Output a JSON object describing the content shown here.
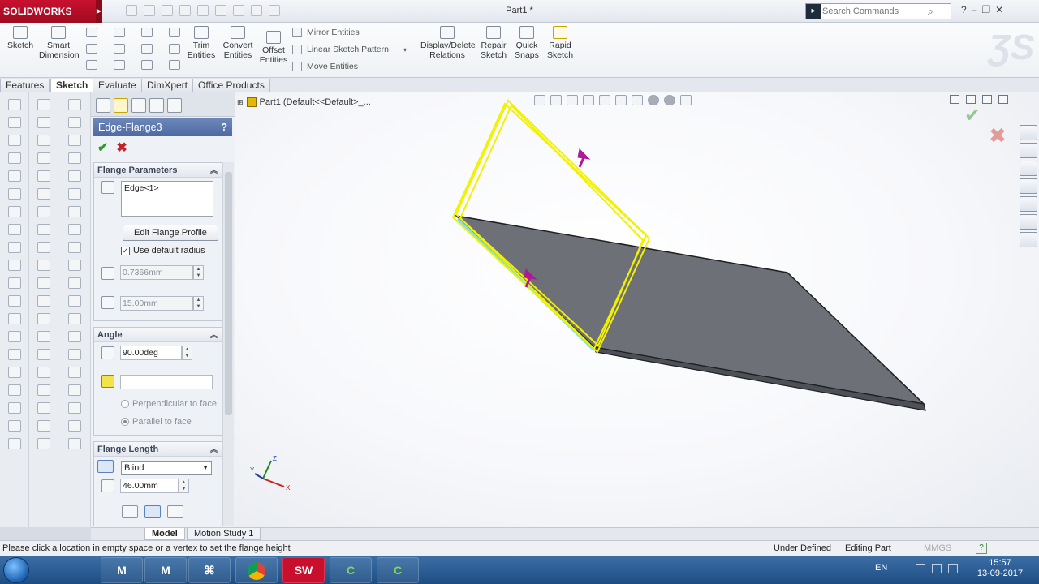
{
  "app": {
    "brand": "SOLIDWORKS",
    "document_title": "Part1 *",
    "search_placeholder": "Search Commands"
  },
  "command_manager": {
    "sketch": "Sketch",
    "smart_dimension": [
      "Smart",
      "Dimension"
    ],
    "trim_entities": [
      "Trim",
      "Entities"
    ],
    "convert_entities": [
      "Convert",
      "Entities"
    ],
    "offset_entities": [
      "Offset",
      "Entities"
    ],
    "mirror_entities": "Mirror Entities",
    "linear_sketch_pattern": "Linear Sketch Pattern",
    "move_entities": "Move Entities",
    "display_delete_relations": [
      "Display/Delete",
      "Relations"
    ],
    "repair_sketch": [
      "Repair",
      "Sketch"
    ],
    "quick_snaps": [
      "Quick",
      "Snaps"
    ],
    "rapid_sketch": [
      "Rapid",
      "Sketch"
    ]
  },
  "tabs": [
    "Features",
    "Sketch",
    "Evaluate",
    "DimXpert",
    "Office Products"
  ],
  "active_tab": "Sketch",
  "feature_tree": {
    "root_label": "Part1  (Default<<Default>_..."
  },
  "property_manager": {
    "title": "Edge-Flange3",
    "help": "?",
    "flange_parameters": {
      "heading": "Flange Parameters",
      "edge_selection": "Edge<1>",
      "edit_profile_button": "Edit Flange Profile",
      "use_default_radius_label": "Use default radius",
      "use_default_radius_checked": true,
      "bend_radius": "0.7366mm",
      "gap_distance": "15.00mm"
    },
    "angle": {
      "heading": "Angle",
      "angle_value": "90.00deg",
      "face_selection": "",
      "option_perpendicular": "Perpendicular to face",
      "option_parallel": "Parallel to face",
      "selected_option": "parallel"
    },
    "flange_length": {
      "heading": "Flange Length",
      "end_condition": "Blind",
      "length_value": "46.00mm"
    }
  },
  "bottom_tabs": [
    "Model",
    "Motion Study 1"
  ],
  "status_bar": {
    "message": "Please click a location in empty space or a vertex to set the flange height",
    "definition_state": "Under Defined",
    "mode": "Editing Part",
    "units": "MMGS",
    "help": "?"
  },
  "taskbar": {
    "apps": [
      "Chrome",
      "SW",
      "C",
      "C"
    ],
    "language": "EN",
    "time": "15:57",
    "date": "13-09-2017"
  },
  "colors": {
    "brand_red": "#c8102e",
    "flange_preview": "#f2f200",
    "sheet_metal": "#6e7078",
    "drag_arrow": "#b0189a"
  },
  "icons": {
    "triad": "coordinate-triad-icon",
    "confirm": "checkmark-icon",
    "cancel": "close-icon"
  }
}
